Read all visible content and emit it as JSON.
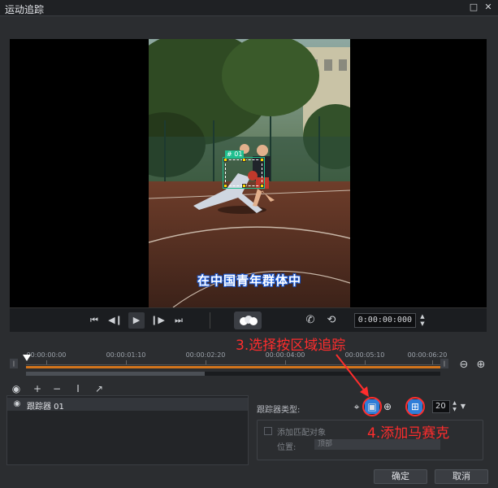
{
  "window": {
    "title": "运动追踪",
    "restore_glyph": "□",
    "close_glyph": "✕"
  },
  "video": {
    "subtitle": "在中国青年群体中",
    "tracker_tag": "# 01"
  },
  "player": {
    "timecode": "0:00:00:000",
    "icons": [
      "skip-to-start-icon",
      "step-back-icon",
      "play-icon",
      "step-forward-icon",
      "skip-to-end-icon",
      "cluster-icon",
      "phone-icon",
      "history-icon"
    ]
  },
  "timeline": {
    "labels": [
      "00:00:00:00",
      "00:00:01:10",
      "00:00:02:20",
      "00:00:04:00",
      "00:00:05:10",
      "00:00:06:20"
    ]
  },
  "annotations": {
    "step3": "3.选择按区域追踪",
    "step4": "4.添加马赛克"
  },
  "trackers": {
    "items": [
      {
        "label": "跟踪器 01"
      }
    ]
  },
  "properties": {
    "tracker_type_label": "跟踪器类型:",
    "size_value": "20",
    "add_match_label": "添加匹配对象",
    "position_label": "位置:",
    "position_value": "顶部"
  },
  "footer": {
    "ok_label": "确定",
    "cancel_label": "取消"
  },
  "colors": {
    "accent": "#2f7ed8",
    "annotation": "#ff2d2d",
    "track": "#d2741c",
    "tracker": "#1fbf8f"
  }
}
